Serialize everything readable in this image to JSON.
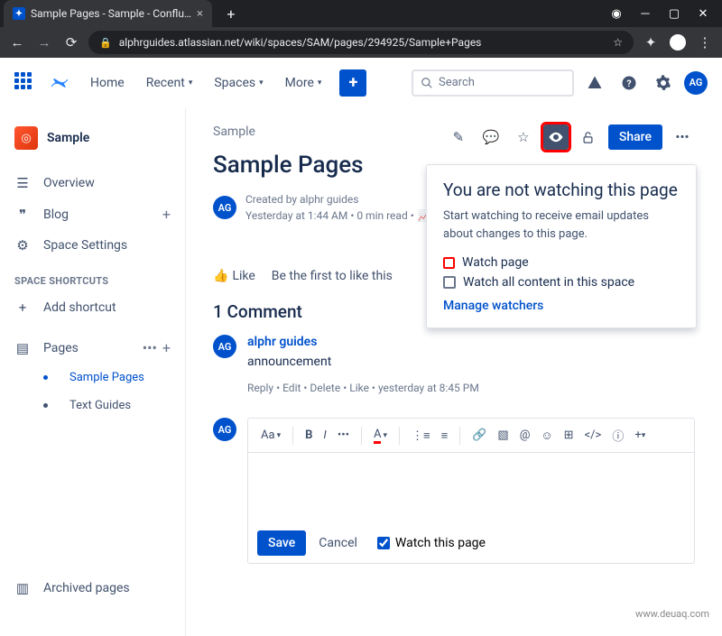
{
  "browser": {
    "tab_title": "Sample Pages - Sample - Conflu…",
    "url": "alphrguides.atlassian.net/wiki/spaces/SAM/pages/294925/Sample+Pages"
  },
  "topnav": {
    "home": "Home",
    "recent": "Recent",
    "spaces": "Spaces",
    "more": "More",
    "search_placeholder": "Search",
    "avatar": "AG"
  },
  "sidebar": {
    "space_name": "Sample",
    "overview": "Overview",
    "blog": "Blog",
    "space_settings": "Space Settings",
    "shortcuts_header": "SPACE SHORTCUTS",
    "add_shortcut": "Add shortcut",
    "pages": "Pages",
    "page_items": [
      "Sample Pages",
      "Text Guides"
    ],
    "archived": "Archived pages"
  },
  "page": {
    "breadcrumb": "Sample",
    "title": "Sample Pages",
    "avatar": "AG",
    "created_by": "Created by alphr guides",
    "meta": "Yesterday at 1:44 AM • 0 min read •",
    "like": "Like",
    "like_prompt": "Be the first to like this",
    "share": "Share"
  },
  "popover": {
    "title": "You are not watching this page",
    "desc": "Start watching to receive email updates about changes to this page.",
    "watch_page": "Watch page",
    "watch_all": "Watch all content in this space",
    "manage": "Manage watchers"
  },
  "comments": {
    "header": "1 Comment",
    "author": "alphr guides",
    "text": "announcement",
    "actions": "Reply  •  Edit  •  Delete  •  Like  •  yesterday at 8:45 PM",
    "avatar": "AG"
  },
  "editor": {
    "text_style": "Aa",
    "save": "Save",
    "cancel": "Cancel",
    "watch_this": "Watch this page",
    "avatar": "AG"
  },
  "footer_site": "www.deuaq.com"
}
